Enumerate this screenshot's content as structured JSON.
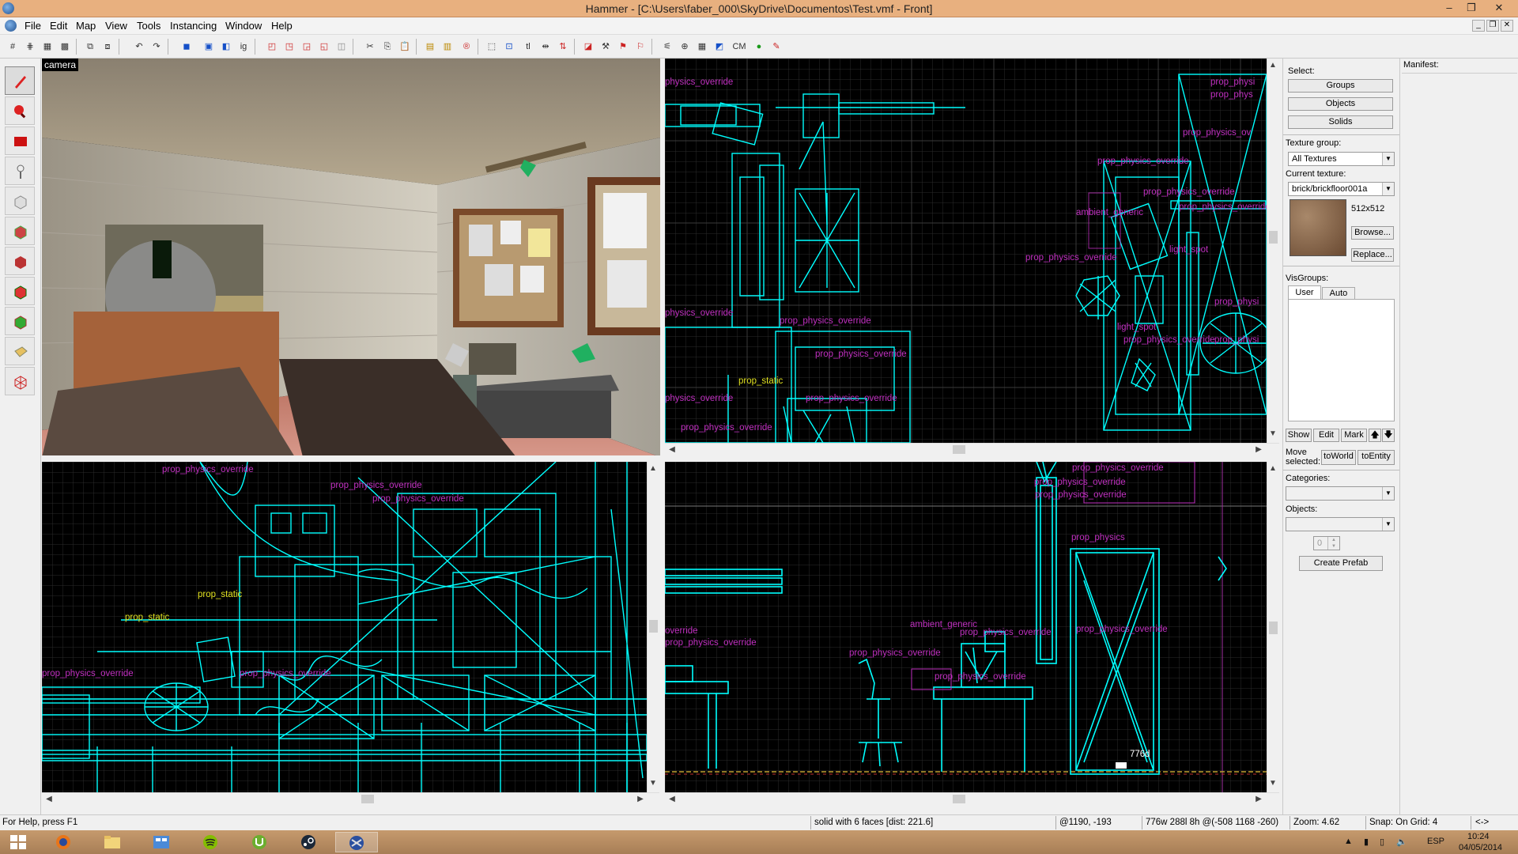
{
  "window": {
    "title": "Hammer - [C:\\Users\\faber_000\\SkyDrive\\Documentos\\Test.vmf - Front]"
  },
  "menu": [
    "File",
    "Edit",
    "Map",
    "View",
    "Tools",
    "Instancing",
    "Window",
    "Help"
  ],
  "toolbar": {
    "cm_label": "CM"
  },
  "viewports": {
    "camera_label": "camera",
    "top_right_labels": [
      "physics_override",
      "prop_physi",
      "prop_phys",
      "prop_physics_ov",
      "prop_physics_override",
      "prop_physics_override",
      "prop_physics_override",
      "ambient_generic",
      "prop_physics_override",
      "light_spot",
      "physics_override",
      "prop_physics_override",
      "prop_physics_override",
      "light_spot",
      "prop_physics_override",
      "prop_static",
      "physics_override",
      "prop_physics_override",
      "prop_physics_override",
      "prop_physi",
      "prop_physi"
    ],
    "bottom_left_labels": [
      "prop_physics_override",
      "prop_physics_override",
      "prop_physics_override",
      "prop_static",
      "prop_static",
      "prop_physics_override",
      "prop_physics_override"
    ],
    "bottom_right_labels": [
      "prop_physics_override",
      "prop_physics_override",
      "prop_physics_override",
      "prop_physics",
      "override",
      "prop_physics_override",
      "ambient_generic",
      "prop_physics_override",
      "prop_physics_override",
      "prop_physics_override",
      "prop_physics_override",
      "776d"
    ]
  },
  "right_panel": {
    "select_label": "Select:",
    "select_buttons": [
      "Groups",
      "Objects",
      "Solids"
    ],
    "texture_group_label": "Texture group:",
    "texture_group_value": "All Textures",
    "current_texture_label": "Current texture:",
    "current_texture_value": "brick/brickfloor001a",
    "texture_size": "512x512",
    "browse": "Browse...",
    "replace": "Replace...",
    "visgroups_label": "VisGroups:",
    "vis_tabs": [
      "User",
      "Auto"
    ],
    "vis_buttons": [
      "Show",
      "Edit",
      "Mark"
    ],
    "move_selected": "Move selected:",
    "to_world": "toWorld",
    "to_entity": "toEntity",
    "categories_label": "Categories:",
    "objects_label": "Objects:",
    "objects_count": "0",
    "create_prefab": "Create Prefab"
  },
  "manifest_label": "Manifest:",
  "status": {
    "help": "For Help, press F1",
    "selection": "solid with 6 faces  [dist: 221.6]",
    "coords": "@1190, -193",
    "size": "776w 288l 8h @(-508 1168 -260)",
    "zoom": "Zoom: 4.62",
    "snap": "Snap: On Grid: 4",
    "nav": "<->"
  },
  "taskbar": {
    "lang": "ESP",
    "time": "10:24",
    "date": "04/05/2014"
  },
  "colors": {
    "wire": "#00ffff",
    "entity_label": "#c030c0",
    "static_label": "#e0e020",
    "grid": "#2a2a2a",
    "titlebar": "#e8b07f"
  }
}
